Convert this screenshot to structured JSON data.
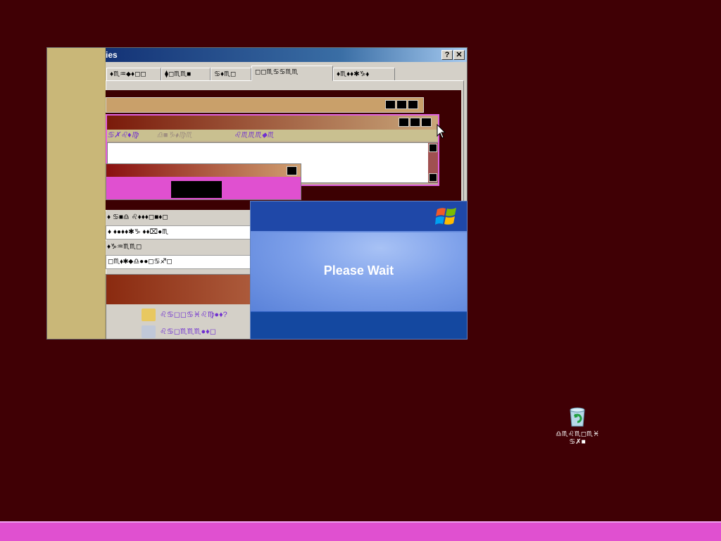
{
  "dialog": {
    "title": "ties",
    "help_label": "?",
    "close_label": "✕",
    "tabs": [
      {
        "label": "♦♏︎♒︎⬥︎♦︎◻︎◻︎"
      },
      {
        "label": "⧫︎◻︎♏︎♏︎■︎"
      },
      {
        "label": "♋︎♦︎♏︎◻︎"
      },
      {
        "label": "◻︎◻︎♏︎♋︎♋︎♏︎♏︎"
      },
      {
        "label": "♦︎♏︎♦︎♦︎✱︎♑︎⬧︎"
      }
    ]
  },
  "preview": {
    "menu_items": [
      "♋︎✗︎♌︎♦︎♍︎",
      "♎︎■︎♑︎⬧︎♍︎♏︎",
      "♌︎♏︎♏︎♏︎⬥︎♏︎"
    ],
    "settings_rows": [
      "♦︎   ♋︎■︎♎︎  ♌︎♦︎♦︎♦︎◻︎■︎♦︎◻︎",
      "♦︎   ♦︎●︎♦︎♦︎✱︎♑︎  ♦︎♦︎⌧︎●︎♏︎",
      "♦︎♑︎♒︎♏︎♏︎◻︎",
      "◻︎♏︎⬧︎✱︎⬥︎♎︎●︎●︎◻︎♋︎♐︎◻︎"
    ],
    "menu_frag_items": [
      "♌︎♋︎◻︎◻︎♋︎♓︎♌︎♍︎●︎♦︎?",
      "♌︎♋︎◻︎♏︎♏︎♏︎●︎♦︎◻︎"
    ]
  },
  "splash": {
    "text": "Please Wait"
  },
  "desktop": {
    "recycle_label": "♎︎♏︎♌︎♏︎◻︎♏︎♓︎ ♋︎✗︎■︎"
  },
  "colors": {
    "desktop": "#400005",
    "taskbar": "#e050d0",
    "splash_blue": "#1a4fb5"
  }
}
